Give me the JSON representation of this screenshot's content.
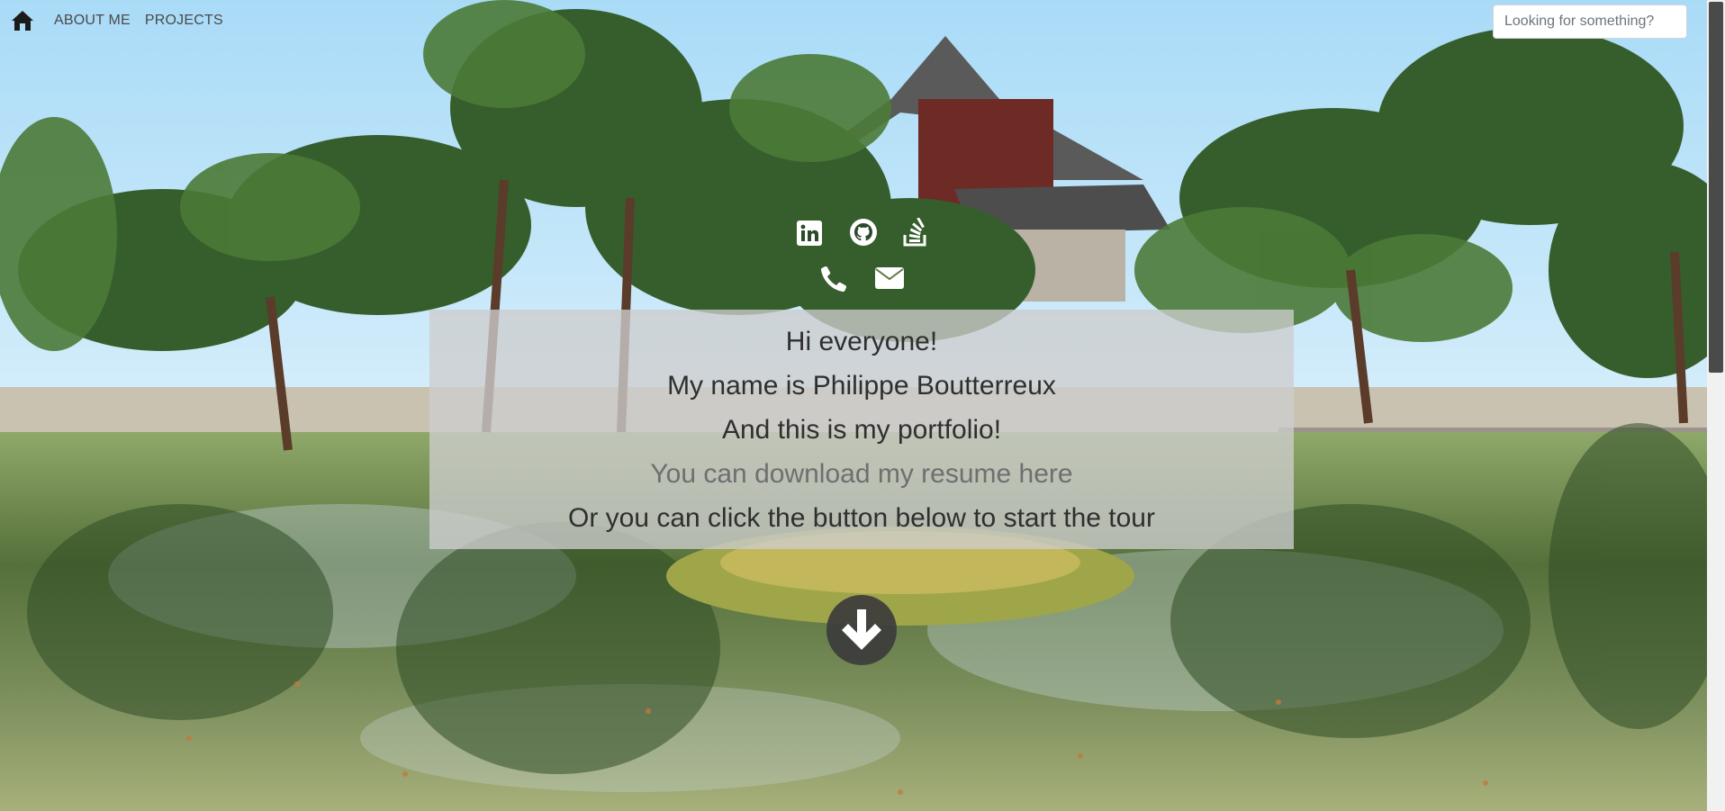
{
  "nav": {
    "home_icon": "home-icon",
    "links": [
      "ABOUT ME",
      "PROJECTS"
    ]
  },
  "search": {
    "placeholder": "Looking for something?",
    "value": ""
  },
  "social": {
    "icons": [
      "linkedin-icon",
      "github-icon",
      "stackoverflow-icon",
      "phone-icon",
      "envelope-icon"
    ]
  },
  "intro": {
    "greeting": "Hi everyone!",
    "name_line": "My name is Philippe Boutterreux",
    "portfolio_line": "And this is my portfolio!",
    "resume_link": "You can download my resume here",
    "tour_line": "Or you can click the button below to start the tour"
  },
  "tour_button": {
    "icon": "arrow-down-icon"
  },
  "colors": {
    "nav_text": "#4a4a4a",
    "card_bg": "#cdcdcd",
    "card_text": "#2f2f2f",
    "link_text": "#6f6f6f",
    "icon_white": "#ffffff",
    "arrow_circle": "#3c3c3c"
  }
}
